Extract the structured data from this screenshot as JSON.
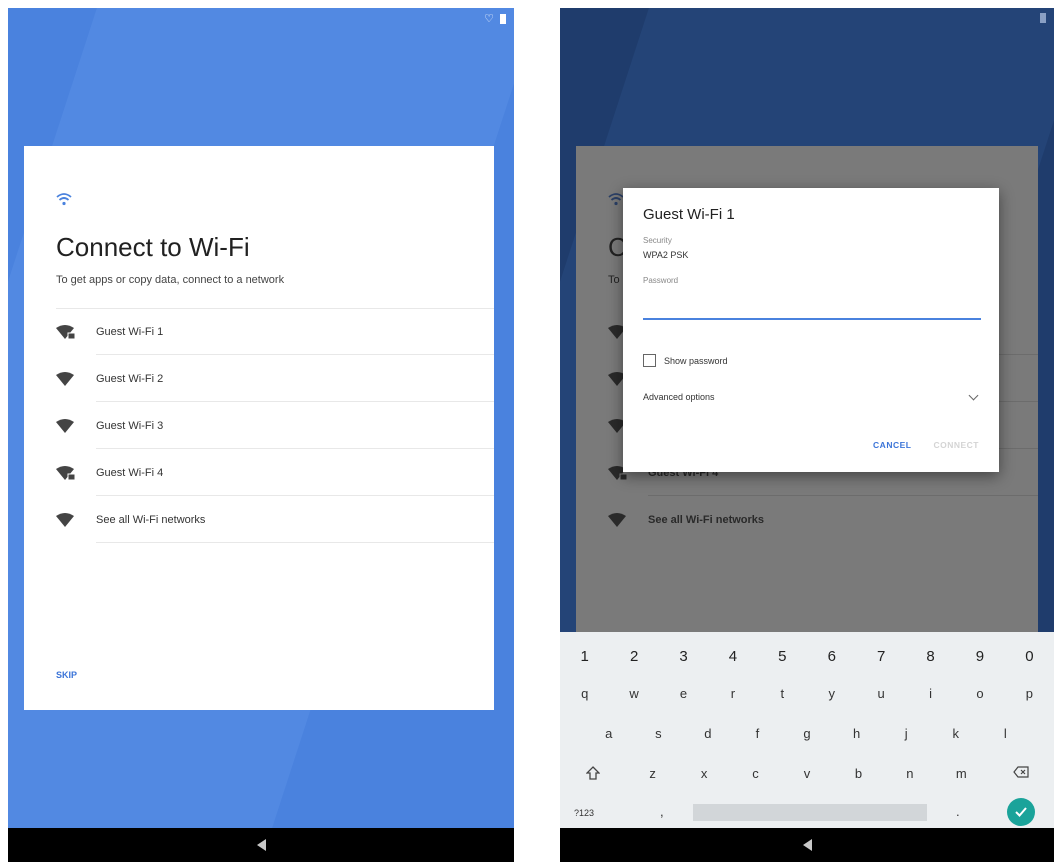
{
  "colors": {
    "accent_blue": "#4a82de",
    "dark_navy": "#1f3c6c",
    "link_blue": "#3b74d8",
    "enter_teal": "#1aa39a"
  },
  "left_screen": {
    "header_icon": "wifi-icon",
    "title": "Connect to Wi-Fi",
    "subtitle": "To get apps or copy data, connect to a network",
    "networks": [
      {
        "label": "Guest Wi-Fi 1",
        "icon": "wifi-lock-icon"
      },
      {
        "label": "Guest Wi-Fi 2",
        "icon": "wifi-icon"
      },
      {
        "label": "Guest Wi-Fi 3",
        "icon": "wifi-icon"
      },
      {
        "label": "Guest Wi-Fi 4",
        "icon": "wifi-lock-icon"
      },
      {
        "label": "See all Wi-Fi networks",
        "icon": "wifi-icon"
      }
    ],
    "skip_label": "SKIP"
  },
  "right_screen": {
    "background_networks": [
      {
        "label": "Guest Wi-Fi 4"
      },
      {
        "label": "See all Wi-Fi networks"
      }
    ],
    "dialog": {
      "title": "Guest Wi-Fi 1",
      "security_label": "Security",
      "security_value": "WPA2 PSK",
      "password_label": "Password",
      "password_value": "",
      "show_password_label": "Show password",
      "advanced_options_label": "Advanced options",
      "cancel_label": "CANCEL",
      "connect_label": "CONNECT"
    },
    "keyboard": {
      "row_numbers": [
        "1",
        "2",
        "3",
        "4",
        "5",
        "6",
        "7",
        "8",
        "9",
        "0"
      ],
      "row_q": [
        "q",
        "w",
        "e",
        "r",
        "t",
        "y",
        "u",
        "i",
        "o",
        "p"
      ],
      "row_a": [
        "a",
        "s",
        "d",
        "f",
        "g",
        "h",
        "j",
        "k",
        "l"
      ],
      "row_z": [
        "z",
        "x",
        "c",
        "v",
        "b",
        "n",
        "m"
      ],
      "symbols_label": "?123",
      "comma": ",",
      "period": "."
    }
  }
}
